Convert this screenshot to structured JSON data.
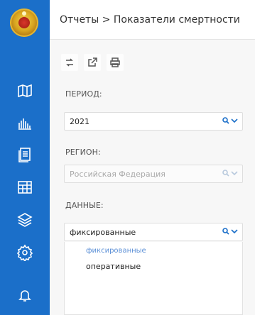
{
  "header": {
    "breadcrumb": "Отчеты > Показатели смертности"
  },
  "sidebar": {
    "items": [
      {
        "icon": "map-icon"
      },
      {
        "icon": "bar-chart-icon"
      },
      {
        "icon": "document-icon"
      },
      {
        "icon": "grid-table-icon"
      },
      {
        "icon": "layers-icon"
      },
      {
        "icon": "gear-icon"
      },
      {
        "icon": "bell-icon"
      }
    ],
    "color": "#1b6fc9"
  },
  "toolbar": {
    "icons": [
      "refresh-icon",
      "export-icon",
      "print-icon"
    ]
  },
  "filters": {
    "period": {
      "label": "ПЕРИОД:",
      "value": "2021"
    },
    "region": {
      "label": "РЕГИОН:",
      "value": "Российская Федерация"
    },
    "data": {
      "label": "ДАННЫЕ:",
      "value": "фиксированные"
    }
  },
  "dropdown": {
    "options": [
      {
        "label": "фиксированные",
        "selected": true
      },
      {
        "label": "оперативные",
        "selected": false
      }
    ]
  },
  "colors": {
    "accent": "#1b6fc9",
    "selected_option": "#5b8fd6"
  }
}
